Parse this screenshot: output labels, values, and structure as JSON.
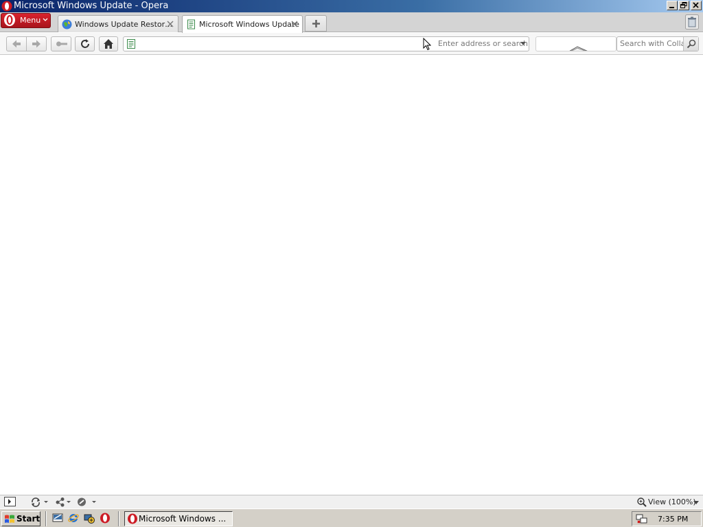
{
  "window": {
    "title": "Microsoft Windows Update - Opera"
  },
  "tabbar": {
    "menu_label": "Menu",
    "tabs": [
      {
        "label": "Windows Update Restor…",
        "active": false
      },
      {
        "label": "Microsoft Windows Update",
        "active": true
      }
    ]
  },
  "navbar": {
    "address_value": "",
    "address_placeholder": "Enter address or search",
    "search_placeholder": "Search with Collab'"
  },
  "statusbar": {
    "zoom_label": "View (100%)"
  },
  "taskbar": {
    "start_label": "Start",
    "task_label": "Microsoft Windows ...",
    "clock": "7:35 PM"
  },
  "colors": {
    "titlebar_start": "#0a246a",
    "opera_red": "#cc1b24"
  }
}
